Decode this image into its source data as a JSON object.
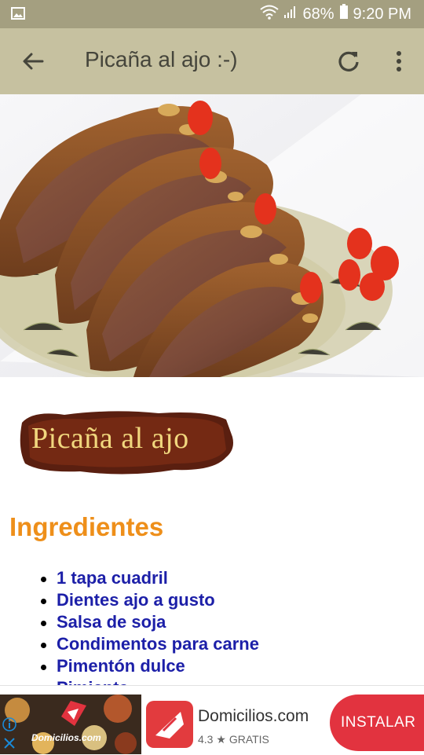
{
  "status_bar": {
    "battery": "68%",
    "time": "9:20 PM",
    "icons": [
      "gallery-icon",
      "wifi-icon",
      "signal-icon",
      "battery-icon"
    ]
  },
  "app_bar": {
    "title": "Picaña al ajo :-)",
    "icons": [
      "back-arrow-icon",
      "refresh-icon",
      "more-vert-icon"
    ]
  },
  "content": {
    "logo_text": "Picaña al ajo",
    "section_title": "Ingredientes",
    "ingredients": [
      "1 tapa cuadril",
      "Dientes ajo a gusto",
      "Salsa de soja",
      "Condimentos para carne",
      "Pimentón dulce",
      "Pimienta"
    ]
  },
  "ad": {
    "thumb_text": "Domicilios.com",
    "app_name": "Domicilios.com",
    "rating": "4.3",
    "price": "GRATIS",
    "install_label": "INSTALAR",
    "colors": {
      "brand": "#e2333f"
    }
  },
  "colors": {
    "status_bar": "#a49f80",
    "app_bar": "#c6c1a0",
    "section_title": "#ee8f1a",
    "ingredient_text": "#1c1fa8"
  }
}
